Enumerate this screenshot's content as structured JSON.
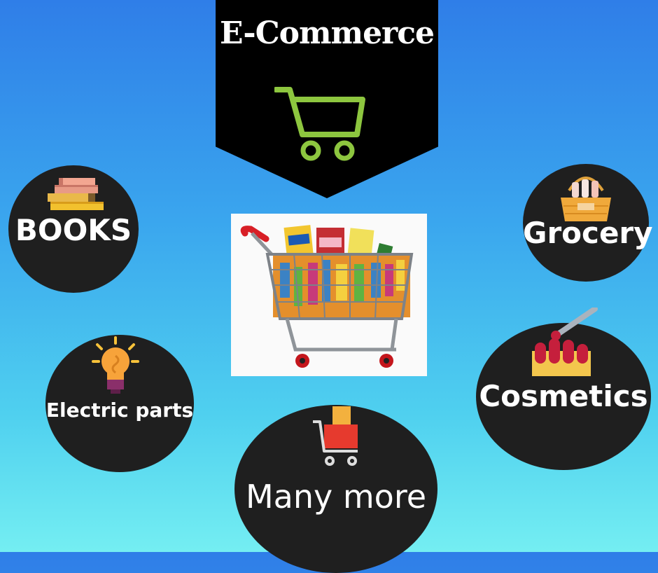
{
  "title": "E-Commerce",
  "categories": {
    "books": "BOOKS",
    "grocery": "Grocery",
    "electric": "Electric parts",
    "cosmetics": "Cosmetics",
    "more": "Many more"
  },
  "icons": {
    "banner": "shopping-cart-icon",
    "books": "books-stack-icon",
    "grocery": "grocery-basket-icon",
    "electric": "light-bulb-icon",
    "cosmetics": "nail-polish-icon",
    "more": "shopping-cart-icon",
    "center": "full-shopping-cart-image"
  },
  "colors": {
    "banner_bg": "#000000",
    "cart_green": "#8dc63f",
    "circle_bg": "#1f1f1f",
    "text": "#ffffff"
  }
}
